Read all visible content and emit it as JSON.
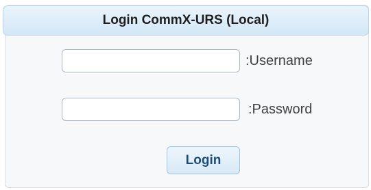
{
  "header": {
    "title": "Login CommX-URS (Local)"
  },
  "form": {
    "username": {
      "label": ":Username",
      "value": "",
      "placeholder": ""
    },
    "password": {
      "label": ":Password",
      "value": "",
      "placeholder": ""
    },
    "login_label": "Login"
  },
  "colors": {
    "header_bg": "#d3e7f6",
    "button_text": "#1d4e7a",
    "field_border": "#a8b7c5"
  }
}
